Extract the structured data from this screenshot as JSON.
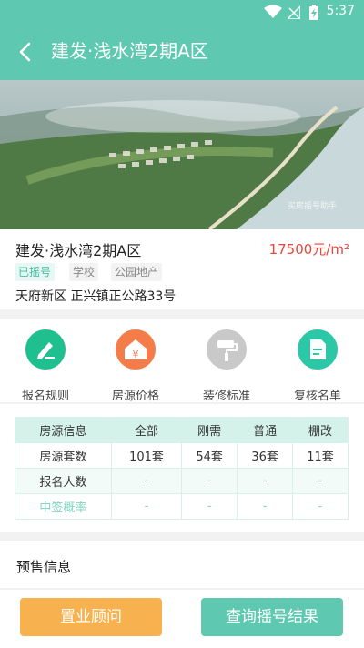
{
  "status_bar": {
    "time": "5:37"
  },
  "header": {
    "title": "建发·浅水湾2期A区"
  },
  "hero": {
    "watermark": "买房摇号助手"
  },
  "project": {
    "name": "建发·浅水湾2期A区",
    "price": "17500元/m²",
    "tags": [
      "已摇号",
      "学校",
      "公园地产"
    ],
    "address": "天府新区 正兴镇正公路33号"
  },
  "menu": {
    "items": [
      {
        "label": "报名规则",
        "icon": "pen-icon",
        "color": "#1fbf8f"
      },
      {
        "label": "房源价格",
        "icon": "money-house-icon",
        "color": "#f47c49"
      },
      {
        "label": "装修标准",
        "icon": "paint-roller-icon",
        "color": "#c9c9c9"
      },
      {
        "label": "复核名单",
        "icon": "document-icon",
        "color": "#2bc7a7"
      }
    ]
  },
  "table": {
    "headers": [
      "房源信息",
      "全部",
      "刚需",
      "普通",
      "棚改"
    ],
    "rows": [
      [
        "房源套数",
        "101套",
        "54套",
        "36套",
        "11套"
      ],
      [
        "报名人数",
        "-",
        "-",
        "-",
        "-"
      ],
      [
        "中签概率",
        "-",
        "-",
        "-",
        "-"
      ]
    ]
  },
  "presale": {
    "label": "预售信息"
  },
  "buttons": {
    "consultant": "置业顾问",
    "lottery_result": "查询摇号结果"
  },
  "colors": {
    "primary": "#5fc8b0",
    "price": "#e8453c",
    "secondary_button": "#f7b24f"
  }
}
